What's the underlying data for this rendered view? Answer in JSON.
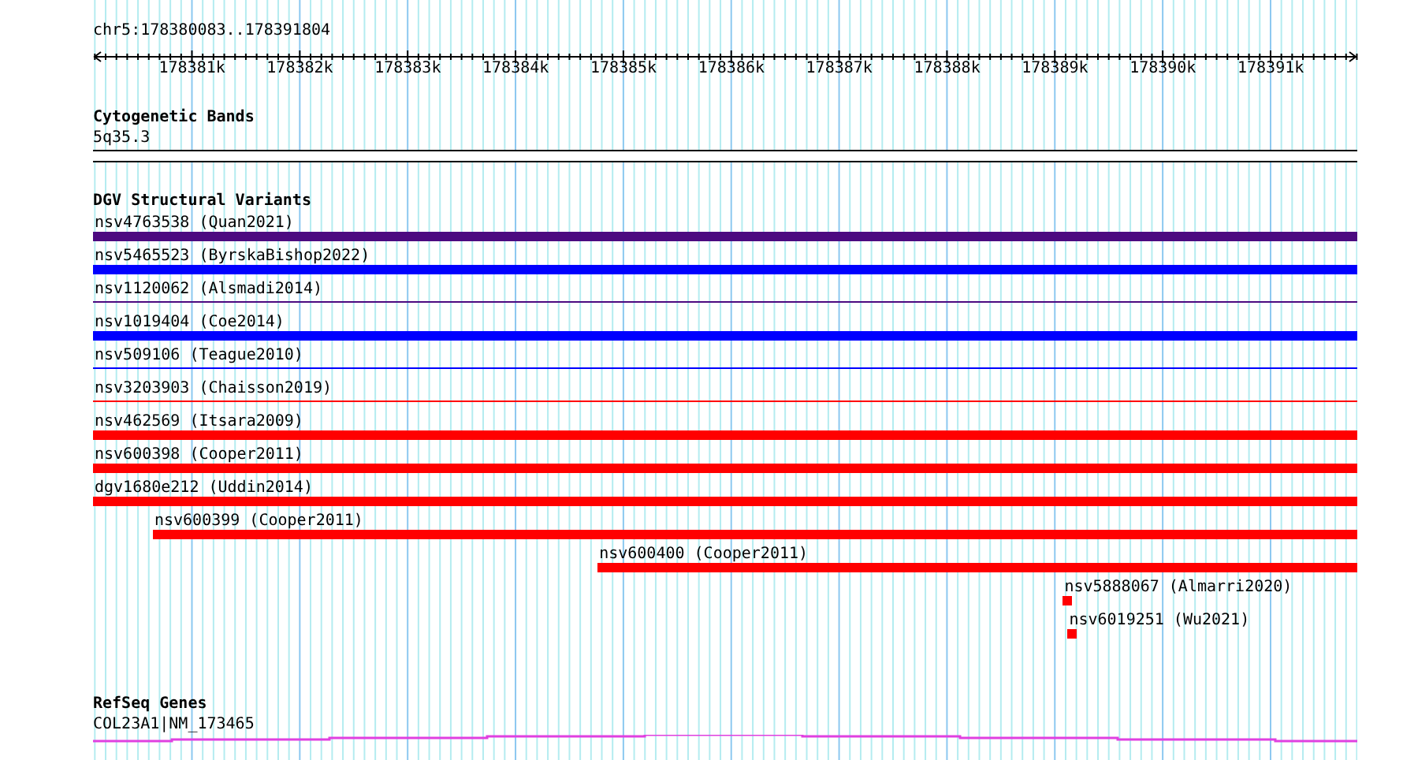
{
  "location": "chr5:178380083..178391804",
  "ruler": {
    "ticks": [
      "178381k",
      "178382k",
      "178383k",
      "178384k",
      "178385k",
      "178386k",
      "178387k",
      "178388k",
      "178389k",
      "178390k",
      "178391k"
    ]
  },
  "tracks": [
    {
      "kind": "cytoband",
      "title": "Cytogenetic Bands",
      "features": [
        {
          "label": "5q35.3"
        }
      ]
    },
    {
      "kind": "variants",
      "title": "DGV Structural Variants",
      "features": [
        {
          "label": "nsv4763538 (Quan2021)",
          "color": "#4c0a80",
          "kind": "bar"
        },
        {
          "label": "nsv5465523 (ByrskaBishop2022)",
          "color": "#0000ff",
          "kind": "bar"
        },
        {
          "label": "nsv1120062 (Alsmadi2014)",
          "color": "#4c0a80",
          "kind": "line"
        },
        {
          "label": "nsv1019404 (Coe2014)",
          "color": "#0000ff",
          "kind": "bar"
        },
        {
          "label": "nsv509106 (Teague2010)",
          "color": "#0000ff",
          "kind": "line"
        },
        {
          "label": "nsv3203903 (Chaisson2019)",
          "color": "#ff0000",
          "kind": "line"
        },
        {
          "label": "nsv462569 (Itsara2009)",
          "color": "#ff0000",
          "kind": "bar"
        },
        {
          "label": "nsv600398 (Cooper2011)",
          "color": "#ff0000",
          "kind": "bar"
        },
        {
          "label": "dgv1680e212 (Uddin2014)",
          "color": "#ff0000",
          "kind": "bar"
        },
        {
          "label": "nsv600399 (Cooper2011)",
          "color": "#ff0000",
          "kind": "bar"
        },
        {
          "label": "nsv600400 (Cooper2011)",
          "color": "#ff0000",
          "kind": "bar"
        },
        {
          "label": "nsv5888067 (Almarri2020)",
          "color": "#ff0000",
          "kind": "bar"
        },
        {
          "label": "nsv6019251 (Wu2021)",
          "color": "#ff0000",
          "kind": "bar"
        }
      ]
    },
    {
      "kind": "gene",
      "title": "RefSeq Genes",
      "features": [
        {
          "label": "COL23A1|NM_173465",
          "color": "#e040e0"
        }
      ]
    }
  ]
}
